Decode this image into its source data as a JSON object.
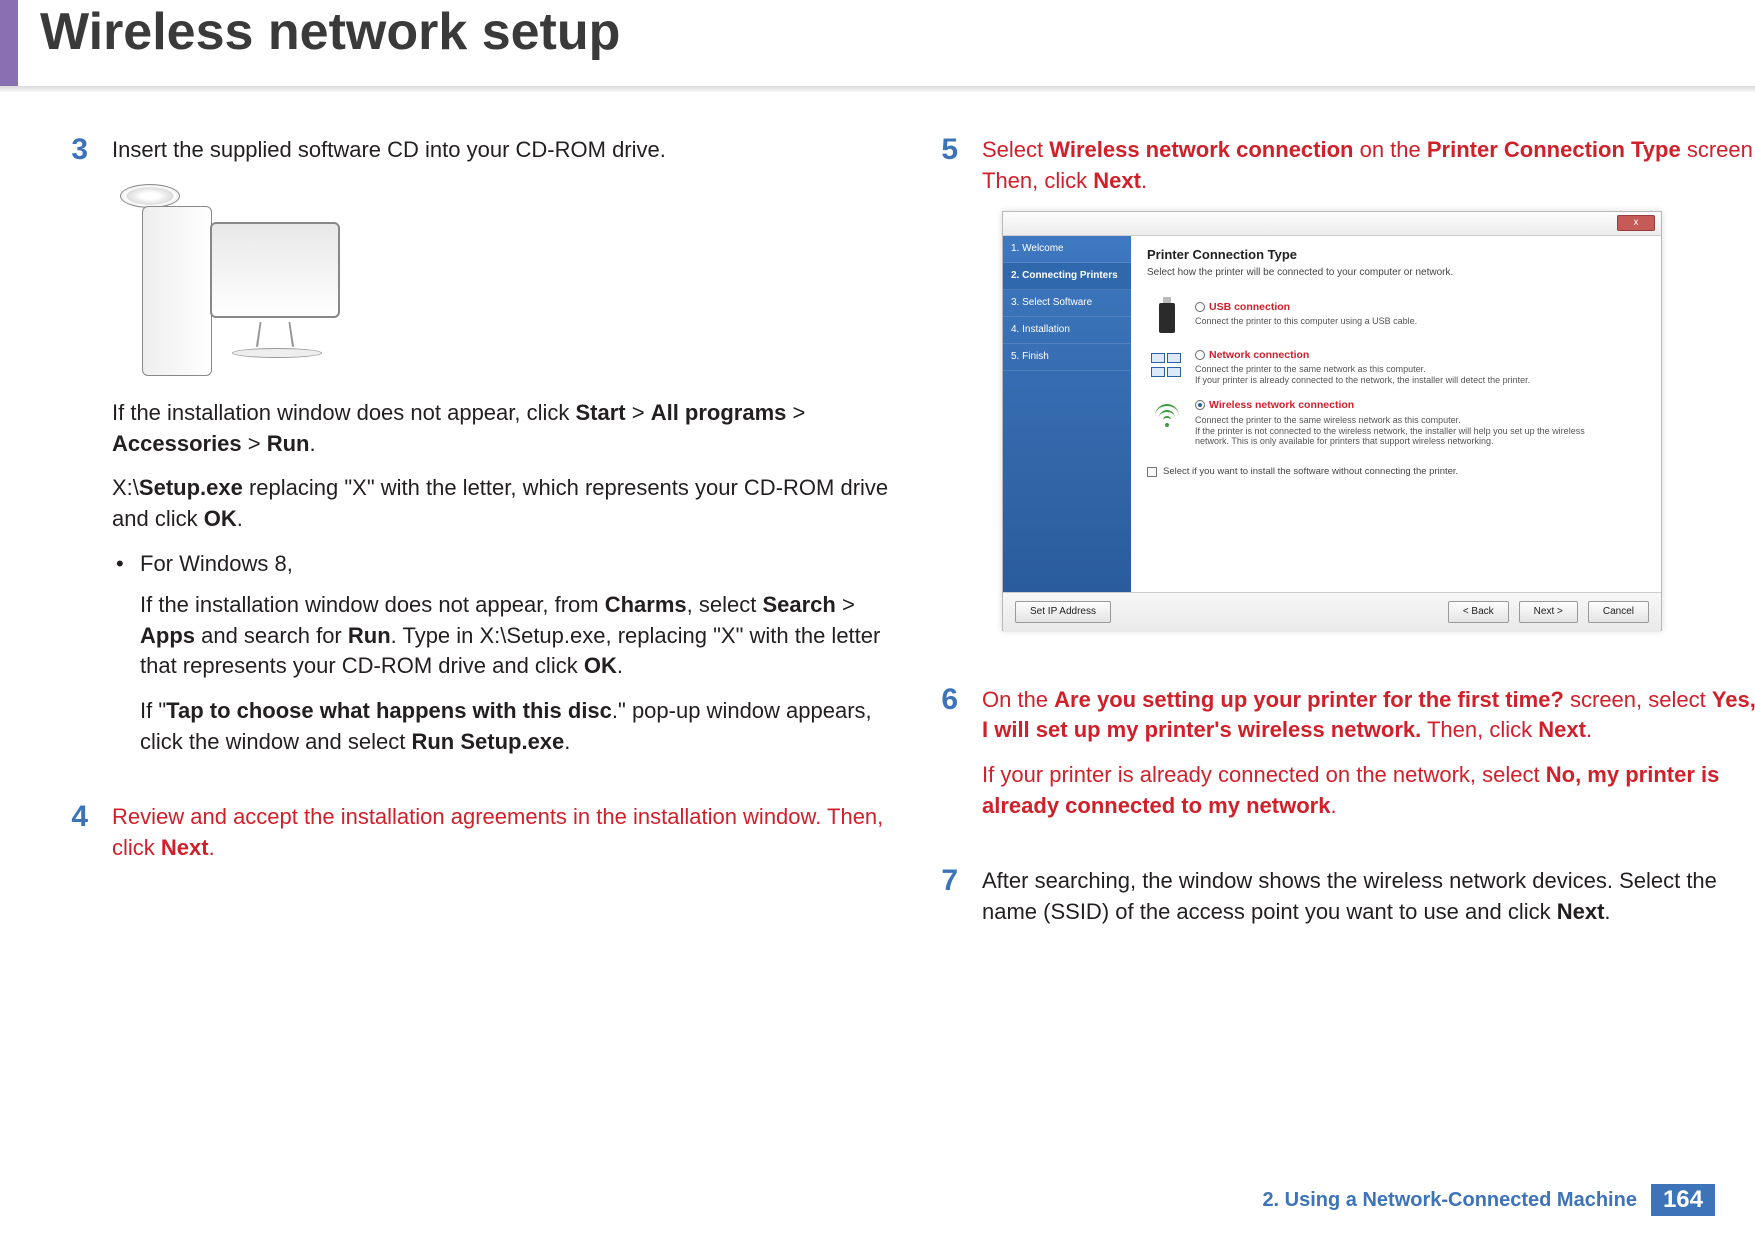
{
  "title": "Wireless network setup",
  "footer": {
    "chapter": "2.  Using a Network-Connected Machine",
    "page": "164"
  },
  "step3": {
    "num": "3",
    "l1": "Insert the supplied software CD into your CD-ROM drive.",
    "p2a": "If the installation window does not appear, click ",
    "p2_start": "Start",
    "p2_gt1": " > ",
    "p2_all": "All programs",
    "p2_gt2": " > ",
    "p2_acc": "Accessories",
    "p2_gt3": " > ",
    "p2_run": "Run",
    "p2_end": ".",
    "p3a": " X:\\",
    "p3_setup": "Setup.exe",
    "p3b": " replacing \"X\" with the letter, which represents your CD-ROM drive and click ",
    "p3_ok": "OK",
    "p3_end": ".",
    "bullet": "For Windows 8,",
    "p4a": "If the installation window does not appear, from ",
    "p4_charms": "Charms",
    "p4b": ", select ",
    "p4_search": "Search",
    "p4_gt": " > ",
    "p4_apps": "Apps",
    "p4c": " and search for ",
    "p4_run": "Run",
    "p4d": ". Type in X:\\Setup.exe, replacing \"X\" with the letter that represents your CD-ROM drive and click ",
    "p4_ok": "OK",
    "p4_end": ".",
    "p5a": "If \"",
    "p5_tap": "Tap to choose what happens with this disc",
    "p5b": ".\" pop-up window appears, click the window and select ",
    "p5_rs": "Run Setup.exe",
    "p5_end": "."
  },
  "step4": {
    "num": "4",
    "t1": "Review and accept the installation agreements in the installation window. Then, click ",
    "t1_next": "Next",
    "t1_end": "."
  },
  "step5": {
    "num": "5",
    "t1": "Select ",
    "t1_wnc": "Wireless network connection",
    "t2": " on the ",
    "t2_pct": "Printer Connection Type",
    "t3": " screen. Then, click ",
    "t3_next": "Next",
    "t3_end": "."
  },
  "wizard": {
    "close": "x",
    "side": [
      "1. Welcome",
      "2. Connecting Printers",
      "3. Select Software",
      "4. Installation",
      "5. Finish"
    ],
    "heading": "Printer Connection Type",
    "sub": "Select how the printer will be connected to your computer or network.",
    "opt1_t": "USB connection",
    "opt1_d": "Connect the printer to this computer using a USB cable.",
    "opt2_t": "Network connection",
    "opt2_d": "Connect the printer to the same network as this computer.\nIf your printer is already connected to the network, the installer will detect the printer.",
    "opt3_t": "Wireless network connection",
    "opt3_d": "Connect the printer to the same wireless network as this computer.\nIf the printer is not connected to the wireless network, the installer will help you set up the wireless network. This is only available for printers that support wireless networking.",
    "chk": "Select if you want to install the software without connecting the printer.",
    "btn_ip": "Set IP Address",
    "btn_back": "< Back",
    "btn_next": "Next >",
    "btn_cancel": "Cancel"
  },
  "step6": {
    "num": "6",
    "t1": "On the ",
    "t1_q": "Are you setting up your printer for the first time?",
    "t2": " screen, select ",
    "t2_yes": "Yes, I will set up my printer's wireless network.",
    "t3": " Then, click ",
    "t3_next": "Next",
    "t3_end": ".",
    "p2a": "If your printer is already connected on the network, select ",
    "p2_no": "No, my printer is already connected to my network",
    "p2_end": "."
  },
  "step7": {
    "num": "7",
    "t1": "After searching, the window shows the wireless network devices. Select the name (SSID) of the access point you want to use and click ",
    "t1_next": "Next",
    "t1_end": "."
  }
}
